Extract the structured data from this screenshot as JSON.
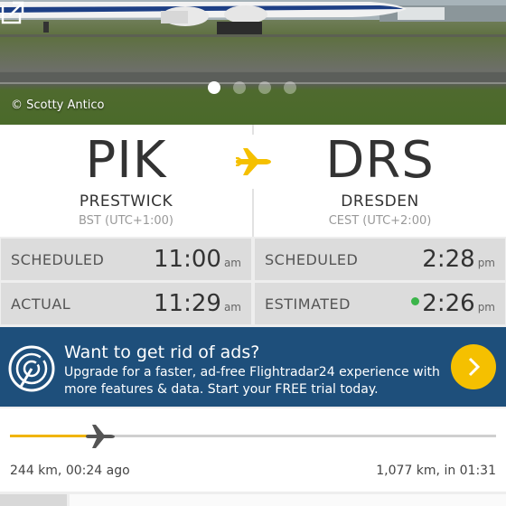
{
  "photo": {
    "credit": "© Scotty Antico",
    "slide_count": 4,
    "active_slide": 1,
    "open_icon": "external-link-icon"
  },
  "route": {
    "origin": {
      "code": "PIK",
      "city": "PRESTWICK",
      "timezone": "BST (UTC+1:00)"
    },
    "destination": {
      "code": "DRS",
      "city": "DRESDEN",
      "timezone": "CEST (UTC+2:00)"
    },
    "plane_icon": "airplane-icon",
    "accent": "#f5c000"
  },
  "times": {
    "departure_scheduled": {
      "label": "SCHEDULED",
      "time": "11:00",
      "ampm": "am"
    },
    "arrival_scheduled": {
      "label": "SCHEDULED",
      "time": "2:28",
      "ampm": "pm"
    },
    "departure_actual": {
      "label": "ACTUAL",
      "time": "11:29",
      "ampm": "am"
    },
    "arrival_estimated": {
      "label": "ESTIMATED",
      "time": "2:26",
      "ampm": "pm",
      "status_color": "#3bb54a"
    }
  },
  "ad": {
    "title": "Want to get rid of ads?",
    "body": "Upgrade for a faster, ad-free Flightradar24 experience with more features & data. Start your FREE trial today.",
    "background": "#1e4f7b",
    "button_icon": "chevron-right-icon"
  },
  "progress": {
    "fraction": 0.185,
    "elapsed": "244 km, 00:24 ago",
    "remaining": "1,077 km, in 01:31",
    "fill_color": "#f0b400"
  }
}
